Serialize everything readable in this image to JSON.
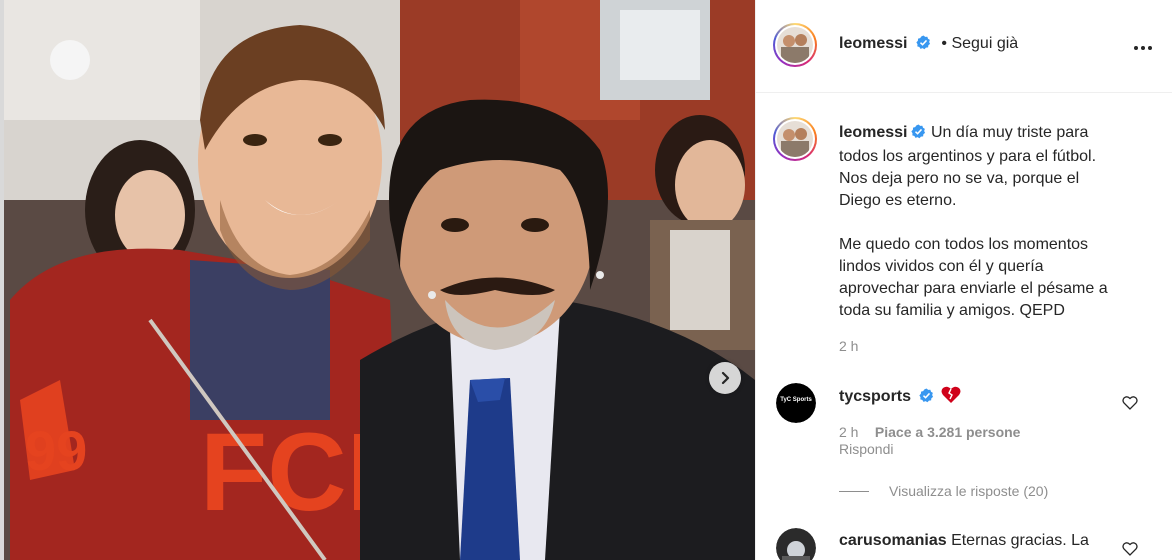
{
  "post": {
    "author": "leomessi",
    "follow_separator": "•",
    "follow_state": "Segui già",
    "caption_lines": [
      "Un día muy triste para",
      "todos los argentinos y para el fútbol.",
      "Nos deja pero no se va, porque el",
      "Diego es eterno."
    ],
    "caption_lines_2": [
      "Me quedo con todos los momentos",
      "lindos vividos con él y quería",
      "aprovechar para enviarle el pésame a",
      "toda su familia y amigos. QEPD"
    ],
    "time": "2 h"
  },
  "comments": [
    {
      "user": "tycsports",
      "text": "",
      "emoji": "broken-heart",
      "time": "2 h",
      "likes": "Piace a 3.281 persone",
      "reply_label": "Rispondi",
      "view_replies": "Visualizza le risposte (20)",
      "avatar_text": "TyC Sports"
    },
    {
      "user": "carusomanias",
      "text": "Eternas gracias. La"
    }
  ],
  "icons": {
    "verified": "verified-badge-icon",
    "more": "more-options-icon",
    "next": "chevron-right-icon",
    "like": "heart-outline-icon"
  },
  "colors": {
    "verified": "#3897f0",
    "text": "#262626",
    "muted": "#8e8e8e",
    "broken_heart": "#d0021b"
  }
}
